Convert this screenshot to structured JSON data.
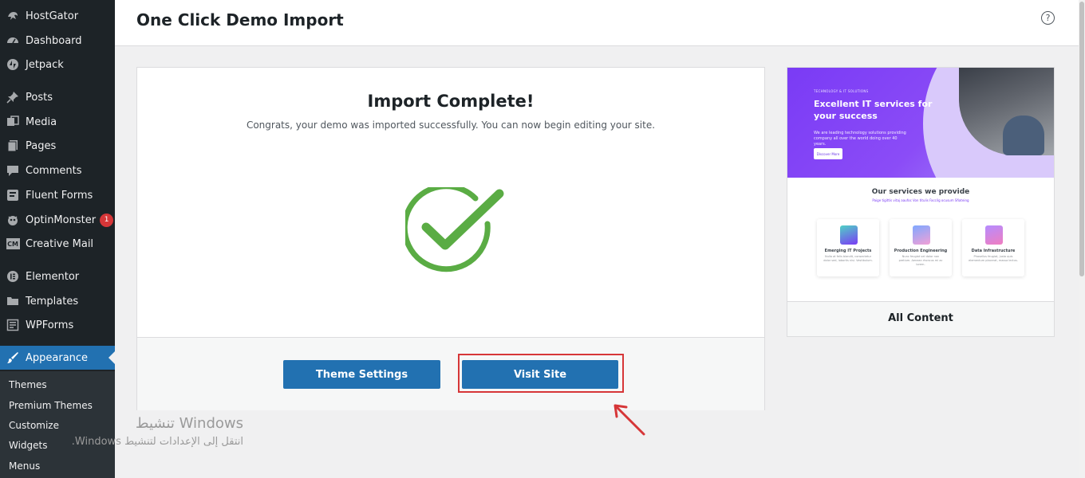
{
  "sidebar": {
    "items": [
      {
        "label": "HostGator",
        "icon": "hostgator-icon"
      },
      {
        "label": "Dashboard",
        "icon": "dashboard-icon"
      },
      {
        "label": "Jetpack",
        "icon": "jetpack-icon"
      },
      {
        "label": "Posts",
        "icon": "pin-icon"
      },
      {
        "label": "Media",
        "icon": "media-icon"
      },
      {
        "label": "Pages",
        "icon": "pages-icon"
      },
      {
        "label": "Comments",
        "icon": "comment-icon"
      },
      {
        "label": "Fluent Forms",
        "icon": "forms-icon"
      },
      {
        "label": "OptinMonster",
        "icon": "optinmonster-icon",
        "badge": "1"
      },
      {
        "label": "Creative Mail",
        "icon": "cm-icon",
        "icon_text": "CM"
      },
      {
        "label": "Elementor",
        "icon": "elementor-icon"
      },
      {
        "label": "Templates",
        "icon": "folder-icon"
      },
      {
        "label": "WPForms",
        "icon": "wpforms-icon"
      },
      {
        "label": "Appearance",
        "icon": "brush-icon",
        "active": true
      }
    ],
    "submenu": [
      "Themes",
      "Premium Themes",
      "Customize",
      "Widgets",
      "Menus"
    ]
  },
  "header": {
    "title": "One Click Demo Import",
    "help_symbol": "?"
  },
  "import": {
    "title": "Import Complete!",
    "subtitle": "Congrats, your demo was imported successfully. You can now begin editing your site.",
    "theme_settings_label": "Theme Settings",
    "visit_site_label": "Visit Site"
  },
  "preview": {
    "label": "All Content",
    "hero": {
      "kicker": "TECHNOLOGY & IT SOLUTIONS",
      "title": "Excellent IT services for your success",
      "text": "We are leading technology solutions providing company all over the world doing over 40 years.",
      "button": "Discover More"
    },
    "services_title": "Our services we provide",
    "services_subtitle": "Paige tigittis vitaj aaufoc Von titulis Faccilg ocusum Sfiateing",
    "services": [
      {
        "name": "Emerging IT Projects",
        "text": "Nulla at felis blandit, consectetur dolor sed, lobortis nisi. Vestibulum."
      },
      {
        "name": "Production Engineering",
        "text": "Nunc feugiat vel dolor non pretium. Aenean rhoncus mi ac lorem."
      },
      {
        "name": "Data Infrastructure",
        "text": "Phasellus feugiat, justo quis elementum placerat, massa lectus."
      }
    ]
  },
  "watermark": {
    "title": "تنشيط Windows",
    "text": "انتقل إلى الإعدادات لتنشيط Windows."
  },
  "colors": {
    "sidebar_bg": "#1d2327",
    "accent": "#2271b1",
    "success": "#5aac44",
    "highlight": "#d63638",
    "hero_purple": "#7a3bf5"
  }
}
